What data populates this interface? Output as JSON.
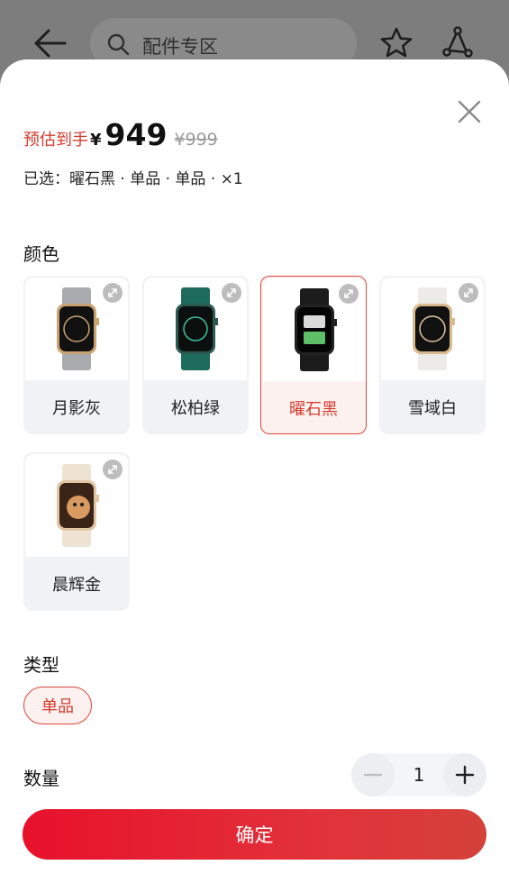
{
  "header": {
    "search_placeholder": "配件专区",
    "icons": [
      "back-arrow-icon",
      "search-icon",
      "star-icon",
      "share-icon"
    ]
  },
  "price": {
    "prefix": "预估到手",
    "currency": "¥",
    "amount": "949",
    "original": "¥999"
  },
  "selection": {
    "text": "已选：曜石黑 · 单品 · 单品 · ×1"
  },
  "color_section": {
    "title": "颜色",
    "options": [
      {
        "label": "月影灰",
        "selected": false,
        "strap": "#a8aaad",
        "bezel": "#c9a271"
      },
      {
        "label": "松柏绿",
        "selected": false,
        "strap": "#1d6b5c",
        "bezel": "#2c5a50"
      },
      {
        "label": "曜石黑",
        "selected": true,
        "strap": "#1c1c1c",
        "bezel": "#222222"
      },
      {
        "label": "雪域白",
        "selected": false,
        "strap": "#ecebe7",
        "bezel": "#d9b98e"
      },
      {
        "label": "晨辉金",
        "selected": false,
        "strap": "#efe3d3",
        "bezel": "#e1c6a5"
      }
    ]
  },
  "type_section": {
    "title": "类型",
    "chip": "单品"
  },
  "quantity_section": {
    "title": "数量",
    "value": "1"
  },
  "confirm_label": "确定",
  "colors": {
    "accent_red": "#d53a2e",
    "button_red": "#e8112b"
  }
}
